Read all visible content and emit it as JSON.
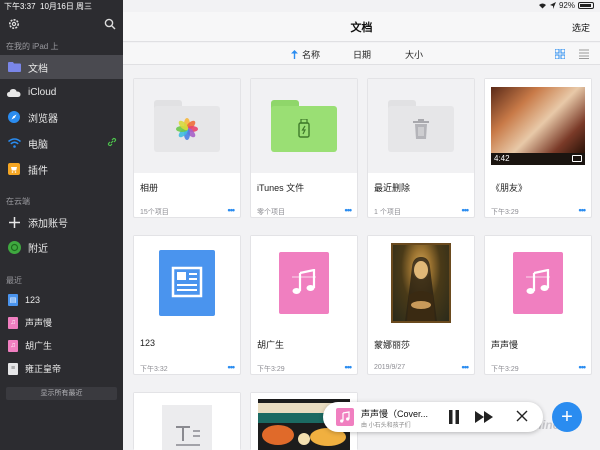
{
  "status": {
    "time": "下午3:37",
    "date": "10月16日 周三",
    "battery": "92%",
    "battery_level": 0.92
  },
  "sidebar": {
    "section_local": "在我的 iPad 上",
    "items": [
      {
        "label": "文档",
        "icon": "folder-icon"
      },
      {
        "label": "iCloud",
        "icon": "cloud-icon"
      },
      {
        "label": "浏览器",
        "icon": "compass-icon"
      },
      {
        "label": "电脑",
        "icon": "wifi-icon"
      },
      {
        "label": "插件",
        "icon": "cart-icon"
      }
    ],
    "section_cloud": "在云端",
    "cloud_items": [
      {
        "label": "添加账号",
        "icon": "plus-icon"
      },
      {
        "label": "附近",
        "icon": "nearby-icon"
      }
    ],
    "section_recent": "最近",
    "recent": [
      {
        "label": "123"
      },
      {
        "label": "声声慢"
      },
      {
        "label": "胡广生"
      },
      {
        "label": "雍正皇帝"
      }
    ],
    "clear_recent": "显示所有最近"
  },
  "header": {
    "title": "文档",
    "select": "选定"
  },
  "sortbar": {
    "name": "名称",
    "date": "日期",
    "size": "大小"
  },
  "files": [
    {
      "name": "相册",
      "meta": "15个项目"
    },
    {
      "name": "iTunes 文件",
      "meta": "零个项目"
    },
    {
      "name": "最近删除",
      "meta": "1 个项目"
    },
    {
      "name": "《朋友》",
      "meta": "下午3:29",
      "duration": "4:42"
    },
    {
      "name": "123",
      "meta": "下午3:32"
    },
    {
      "name": "胡广生",
      "meta": "下午3:29"
    },
    {
      "name": "蒙娜丽莎",
      "meta": "2019/9/27"
    },
    {
      "name": "声声慢",
      "meta": "下午3:29"
    }
  ],
  "more_label": "•••",
  "player": {
    "title": "声声慢（Cover...",
    "subtitle": "由 小石头和孩子们"
  },
  "fab_label": "+",
  "watermark": "pconline"
}
